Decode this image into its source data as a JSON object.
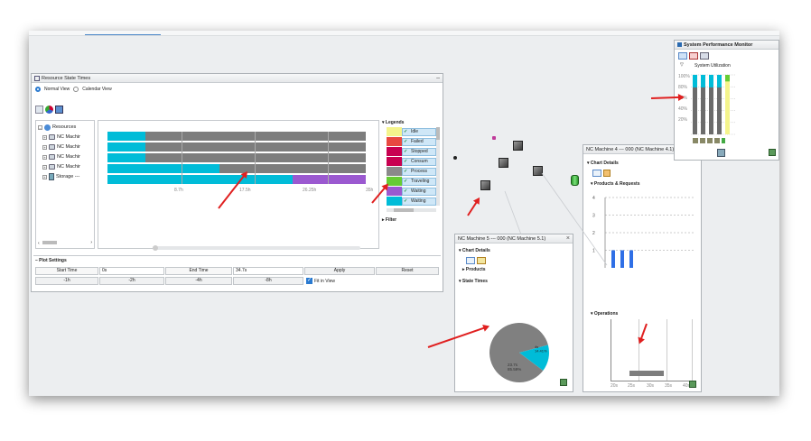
{
  "resource_window": {
    "title": "Resource State Times",
    "view_options": [
      "Normal View",
      "Calendar View"
    ],
    "tree": [
      "Resources",
      "NC Machir",
      "NC Machir",
      "NC Machir",
      "NC Machir",
      "Storage ---"
    ],
    "gantt_ticks": [
      "8.7h",
      "17.5h",
      "26.25h",
      "35h"
    ],
    "legends_title": "Legends",
    "legend_items": [
      "Idle",
      "Failed",
      "Stopped",
      "Consum",
      "Process",
      "Traveling",
      "Waiting",
      "Waiting"
    ],
    "filter_label": "Filter",
    "plot_settings_label": "Plot Settings",
    "start_time_label": "Start Time",
    "start_time_value": "0s",
    "end_time_label": "End Time",
    "end_time_value": "34.7s",
    "apply_label": "Apply",
    "reset_label": "Reset",
    "quick_buttons": [
      "-1h",
      "-2h",
      "-4h",
      "-8h"
    ],
    "fit_in_view_label": "Fit in View"
  },
  "nc51_window": {
    "title": "NC Machine 5 --- 000 (NC Machine 5.1)",
    "chart_details": "Chart Details",
    "products": "Products",
    "state_times": "State Times",
    "pie_label_gray": "23.7s\n85.59%",
    "pie_label_cyan": "4s\n14.41%"
  },
  "nc41_window": {
    "title": "NC Machine 4 --- 000 (NC Machine 4.1)",
    "chart_details": "Chart Details",
    "products_requests": "Products & Requests",
    "y_ticks": [
      "4",
      "3",
      "2",
      "1"
    ],
    "operations": "Operations",
    "ops_ticks": [
      "20s",
      "25s",
      "30s",
      "35s",
      "40s"
    ]
  },
  "sys_window": {
    "title": "System Performance Monitor",
    "subtitle": "System Utilization",
    "y_ticks": [
      "100%",
      "80%",
      "60%",
      "40%",
      "20%"
    ]
  },
  "chart_data": [
    {
      "type": "bar",
      "title": "State Times",
      "categories": [
        "Processing",
        "Waiting"
      ],
      "values": [
        85.59,
        14.41
      ],
      "seconds": [
        23.7,
        4
      ]
    },
    {
      "type": "bar",
      "title": "Products & Requests",
      "categories": [
        "1",
        "2",
        "3"
      ],
      "values": [
        1,
        1,
        1
      ],
      "ylim": [
        0,
        4
      ]
    },
    {
      "type": "bar",
      "title": "System Utilization",
      "categories": [
        "1",
        "2",
        "3",
        "4",
        "5"
      ],
      "values": [
        85,
        85,
        85,
        85,
        95
      ],
      "ylim": [
        0,
        100
      ]
    }
  ],
  "colors": {
    "cyan": "#00bcd8",
    "gray": "#808080",
    "purple": "#9b59d0",
    "yellow": "#f4f48c",
    "red": "#e84840",
    "magenta": "#c80050",
    "olive": "#9e9e9e",
    "green": "#66cc33",
    "blue": "#2f6fe6"
  }
}
